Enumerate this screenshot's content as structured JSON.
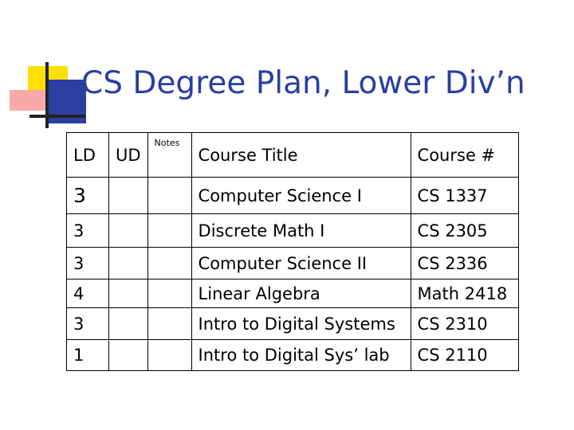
{
  "title": "CS Degree Plan, Lower Div’n",
  "table": {
    "headers": {
      "ld": "LD",
      "ud": "UD",
      "notes": "Notes",
      "course_title": "Course Title",
      "course_num": "Course #"
    },
    "rows": [
      {
        "ld": "3",
        "ud": "",
        "notes": "",
        "course_title": "Computer Science I",
        "course_num": "CS 1337"
      },
      {
        "ld": "3",
        "ud": "",
        "notes": "",
        "course_title": "Discrete Math I",
        "course_num": "CS 2305"
      },
      {
        "ld": "3",
        "ud": "",
        "notes": "",
        "course_title": "Computer Science II",
        "course_num": "CS 2336"
      },
      {
        "ld": "4",
        "ud": "",
        "notes": "",
        "course_title": "Linear Algebra",
        "course_num": "Math 2418"
      },
      {
        "ld": "3",
        "ud": "",
        "notes": "",
        "course_title": "Intro to Digital Systems",
        "course_num": "CS 2310"
      },
      {
        "ld": "1",
        "ud": "",
        "notes": "",
        "course_title": "Intro to Digital Sys’ lab",
        "course_num": "CS 2110"
      }
    ]
  },
  "colors": {
    "title": "#2a3fa0",
    "logo_yellow": "#ffe000",
    "logo_red": "#f9a9a9",
    "logo_blue": "#2a3fa0"
  },
  "icons": {
    "logo": "slide-corner-logo-icon"
  }
}
